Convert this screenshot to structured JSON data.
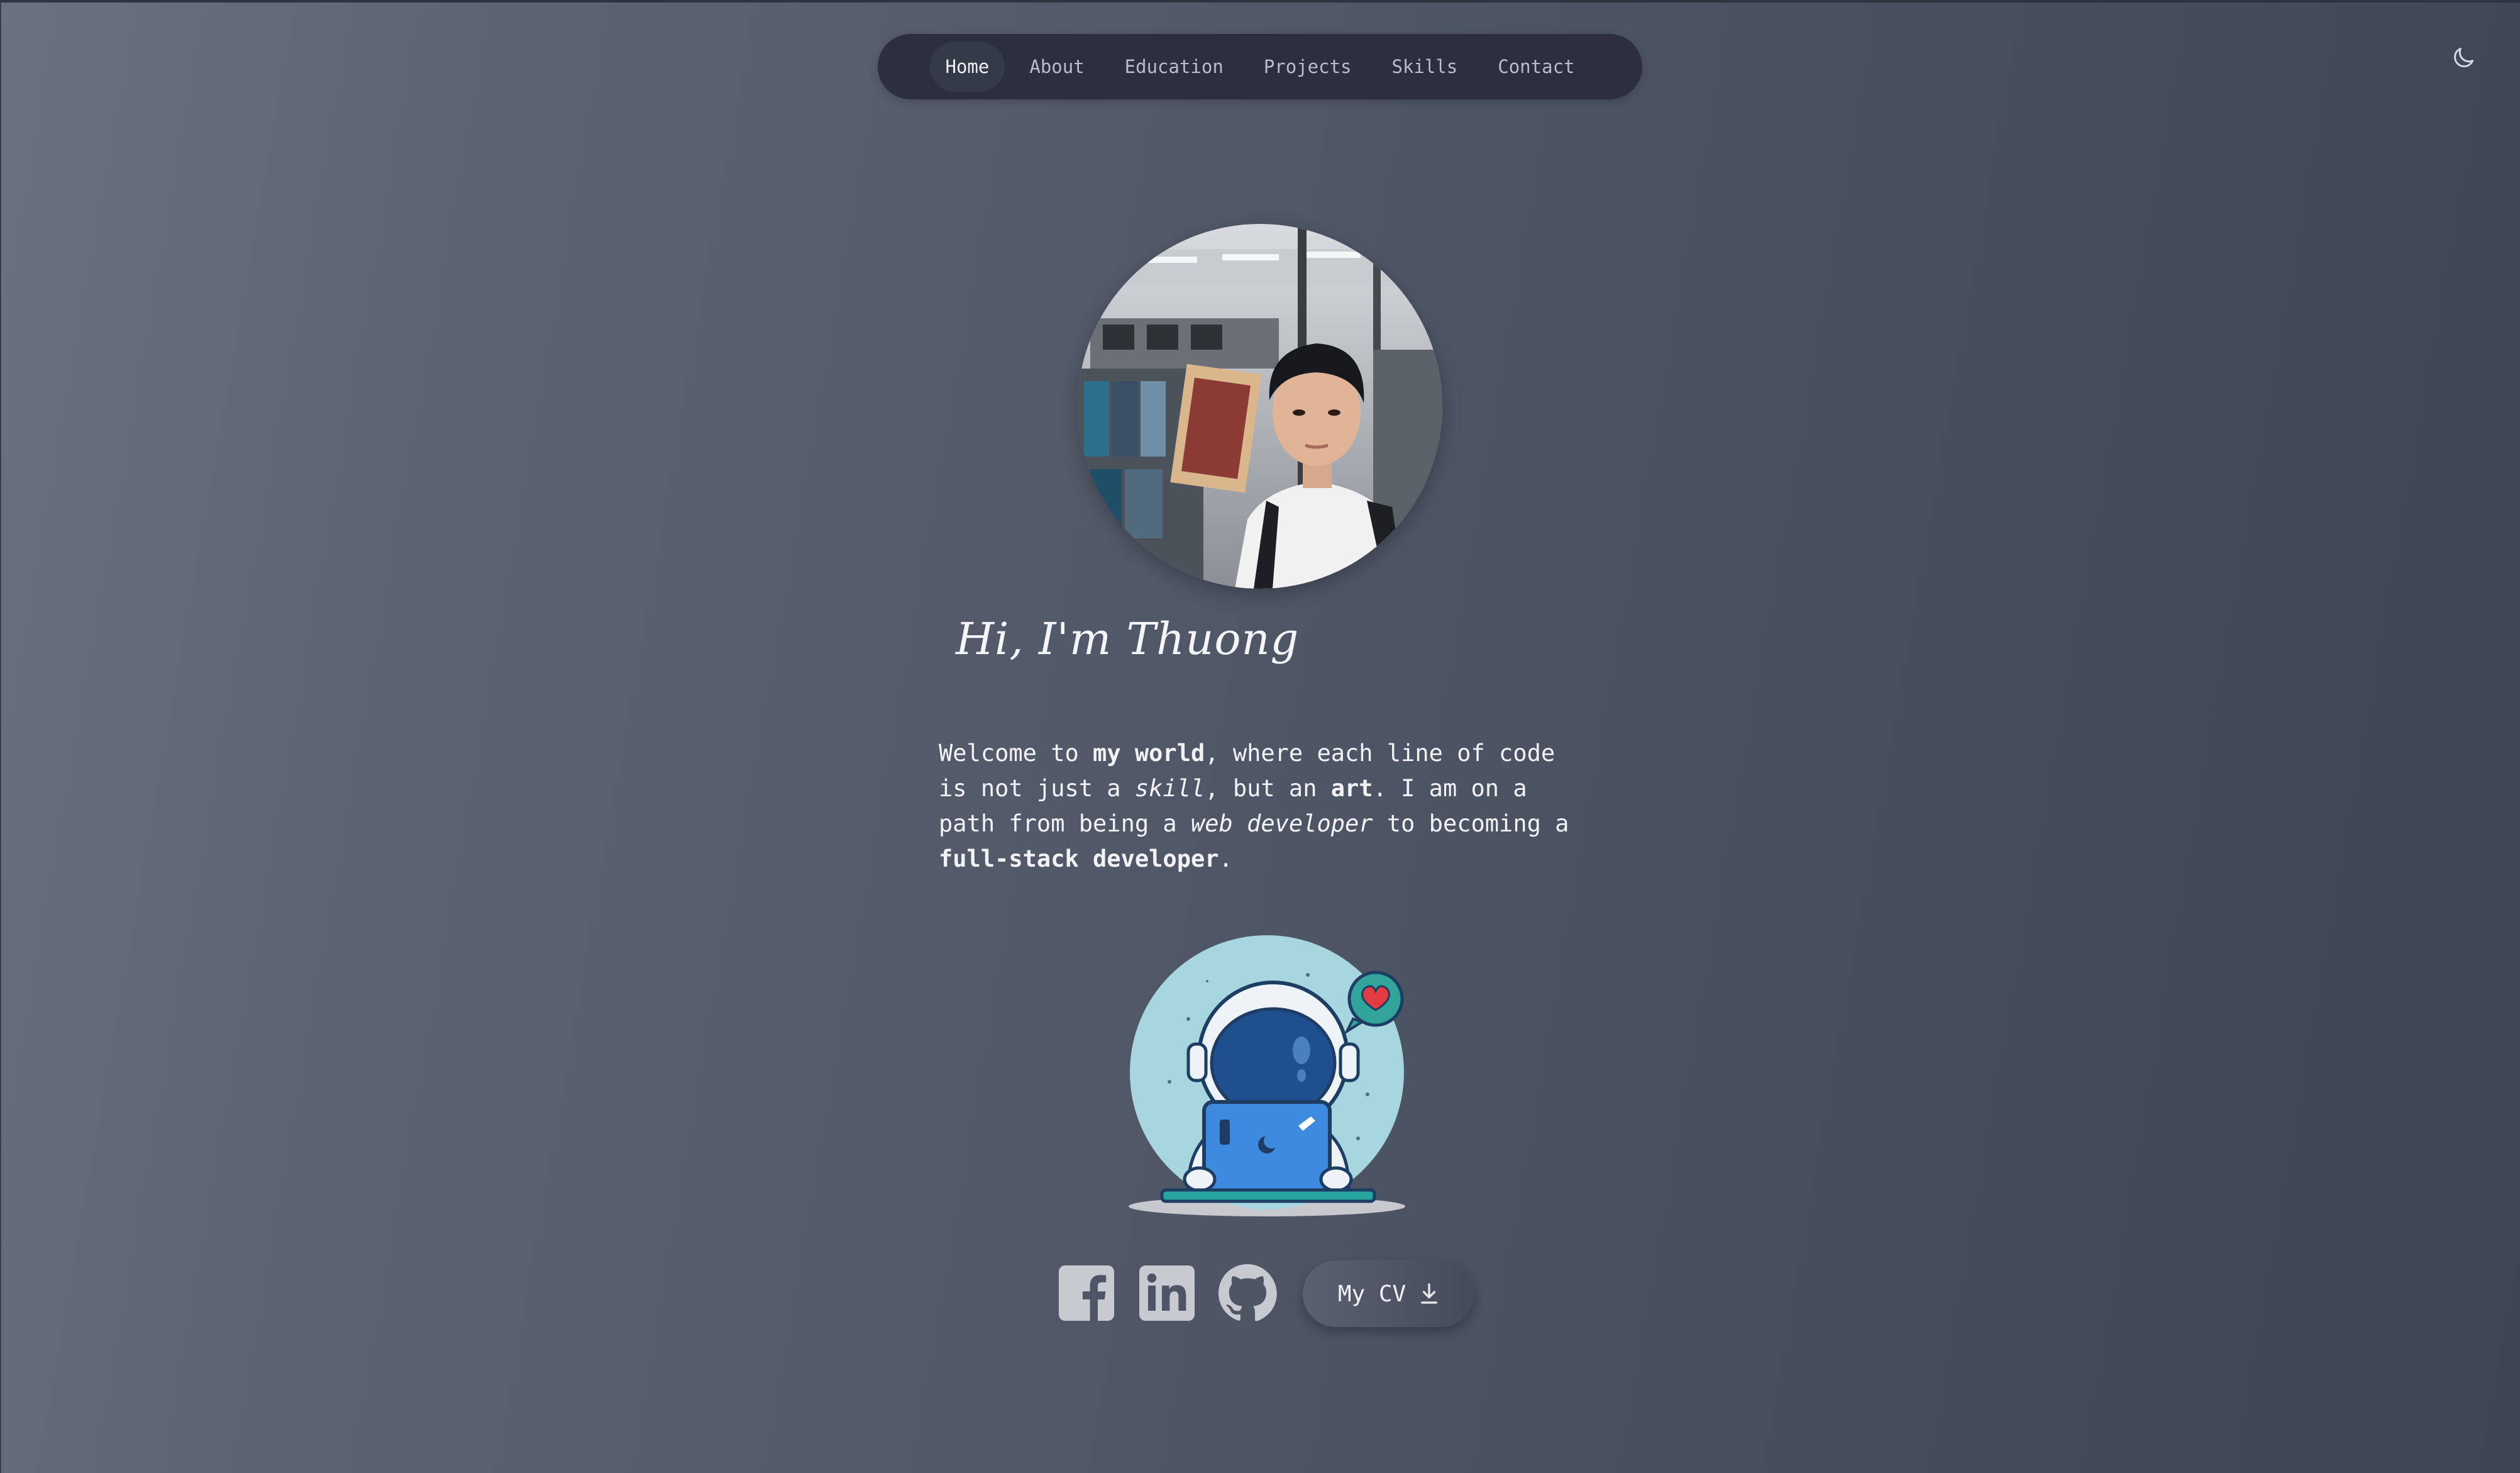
{
  "nav": {
    "items": [
      {
        "label": "Home",
        "active": true
      },
      {
        "label": "About"
      },
      {
        "label": "Education"
      },
      {
        "label": "Projects"
      },
      {
        "label": "Skills"
      },
      {
        "label": "Contact"
      }
    ]
  },
  "theme_toggle": {
    "icon": "moon-icon"
  },
  "hero": {
    "greeting": "Hi, I'm Thuong",
    "intro": {
      "t1": "Welcome to ",
      "b1": "my world",
      "t2": ", where each line of code is not just a ",
      "i1": "skill",
      "t3": ", but an ",
      "b2": "art",
      "t4": ". I am on a path from being a ",
      "i2": "web developer",
      "t5": " to becoming a ",
      "b3": "full-stack developer",
      "t6": "."
    }
  },
  "social": {
    "facebook_icon": "facebook-icon",
    "linkedin_icon": "linkedin-icon",
    "github_icon": "github-icon"
  },
  "cv_button": {
    "label": "My CV",
    "icon": "download-icon"
  },
  "colors": {
    "nav_bg": "#2b303c",
    "nav_active_bg": "#343a47",
    "nav_text": "#b9bec9",
    "accent_teal": "#a7d6de",
    "laptop_blue": "#3d8ae0",
    "heart_red": "#e23b44"
  }
}
